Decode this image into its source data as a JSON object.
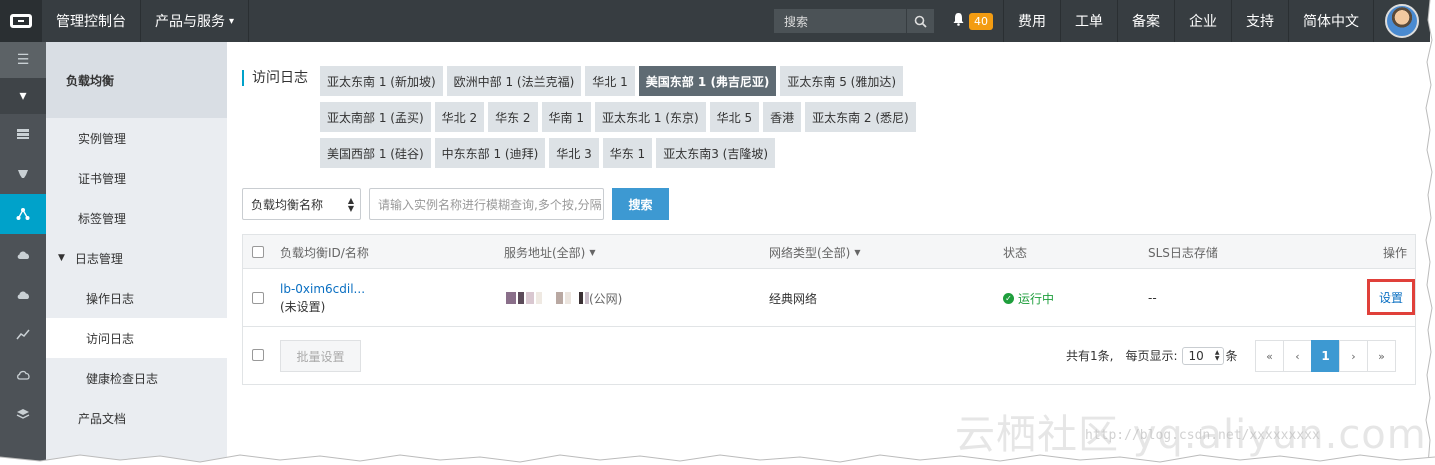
{
  "topbar": {
    "console": "管理控制台",
    "products": "产品与服务",
    "search_placeholder": "搜索",
    "notifications": "40",
    "links": [
      "费用",
      "工单",
      "备案",
      "企业",
      "支持",
      "简体中文"
    ]
  },
  "rail_icons": [
    "menu-icon",
    "dropdown-icon",
    "server-icon",
    "chip-icon",
    "load-balancer-icon",
    "cloud-up-icon",
    "cloud-icon",
    "chart-icon",
    "cloud-outline-icon",
    "layers-icon"
  ],
  "sidebar": {
    "title": "负载均衡",
    "items": [
      {
        "label": "实例管理"
      },
      {
        "label": "证书管理"
      },
      {
        "label": "标签管理"
      },
      {
        "label": "日志管理"
      },
      {
        "label": "操作日志"
      },
      {
        "label": "访问日志"
      },
      {
        "label": "健康检查日志"
      },
      {
        "label": "产品文档"
      }
    ]
  },
  "regions": {
    "label": "访问日志",
    "rows": [
      [
        "亚太东南 1 (新加坡)",
        "欧洲中部 1 (法兰克福)",
        "华北 1",
        "美国东部 1 (弗吉尼亚)",
        "亚太东南 5 (雅加达)"
      ],
      [
        "亚太南部 1 (孟买)",
        "华北 2",
        "华东 2",
        "华南 1",
        "亚太东北 1 (东京)",
        "华北 5",
        "香港",
        "亚太东南 2 (悉尼)"
      ],
      [
        "美国西部 1 (硅谷)",
        "中东东部 1 (迪拜)",
        "华北 3",
        "华东 1",
        "亚太东南3 (吉隆坡)"
      ]
    ],
    "selected": "美国东部 1 (弗吉尼亚)"
  },
  "filter": {
    "select_value": "负载均衡名称",
    "input_placeholder": "请输入实例名称进行模糊查询,多个按,分隔",
    "search_button": "搜索"
  },
  "table": {
    "headers": {
      "id": "负载均衡ID/名称",
      "address": "服务地址(全部)",
      "network": "网络类型(全部)",
      "status": "状态",
      "sls": "SLS日志存储",
      "op": "操作"
    },
    "rows": [
      {
        "id": "lb-0xim6cdil...",
        "name": "(未设置)",
        "address_suffix": "(公网)",
        "network": "经典网络",
        "status": "运行中",
        "sls": "--",
        "op": "设置"
      }
    ],
    "batch_button": "批量设置",
    "total_text": "共有1条,",
    "per_page_label": "每页显示:",
    "per_page_value": "10",
    "per_page_unit": "条",
    "pages": {
      "first": "«",
      "prev": "‹",
      "current": "1",
      "next": "›",
      "last": "»"
    }
  },
  "watermark": {
    "text": "云栖社区 yq.aliyun.com",
    "url": "http://blog.csdn.net/xxxxxxxxx"
  }
}
